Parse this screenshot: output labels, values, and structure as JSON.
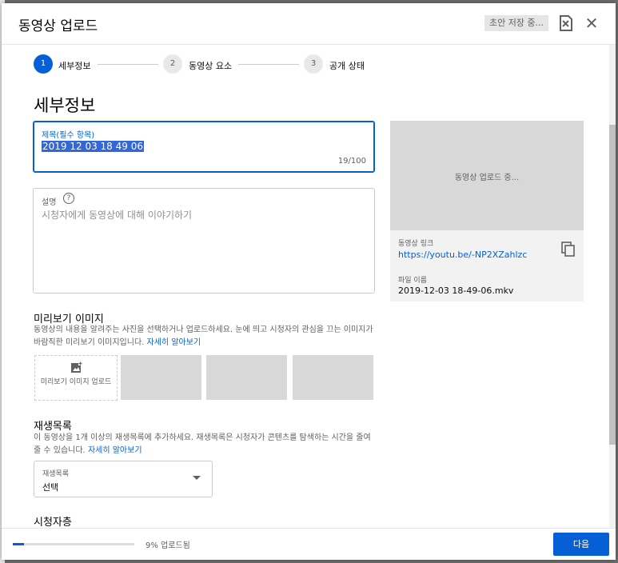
{
  "header": {
    "title": "동영상 업로드",
    "draft_status": "초안 저장 중..."
  },
  "stepper": {
    "steps": [
      {
        "number": "1",
        "label": "세부정보"
      },
      {
        "number": "2",
        "label": "동영상 요소"
      },
      {
        "number": "3",
        "label": "공개 상태"
      }
    ]
  },
  "details": {
    "heading": "세부정보",
    "title_field": {
      "label": "제목(필수 항목)",
      "value": "2019 12 03 18 49 06",
      "counter": "19/100"
    },
    "description_field": {
      "label": "설명",
      "placeholder": "시청자에게 동영상에 대해 이야기하기"
    }
  },
  "preview": {
    "status": "동영상 업로드 중...",
    "link_label": "동영상 링크",
    "link": "https://youtu.be/-NP2XZahlzc",
    "file_label": "파일 이름",
    "file_name": "2019-12-03 18-49-06.mkv"
  },
  "thumbnails": {
    "heading": "미리보기 이미지",
    "description": "동영상의 내용을 알려주는 사진을 선택하거나 업로드하세요. 눈에 띄고 시청자의 관심을 끄는 이미지가 바람직한 미리보기 이미지입니다.",
    "learn_more": "자세히 알아보기",
    "upload_label": "미리보기 이미지 업로드"
  },
  "playlist": {
    "heading": "재생목록",
    "description": "이 동영상을 1개 이상의 재생목록에 추가하세요. 재생목록은 시청자가 콘텐츠를 탐색하는 시간을 줄여줄 수 있습니다.",
    "learn_more": "자세히 알아보기",
    "select_label": "재생목록",
    "select_value": "선택"
  },
  "audience": {
    "heading": "시청자층"
  },
  "footer": {
    "progress_percent": 9,
    "progress_text": "9% 업로드됨",
    "next_label": "다음"
  },
  "colors": {
    "accent": "#065fd4",
    "selection": "#3367d6"
  }
}
